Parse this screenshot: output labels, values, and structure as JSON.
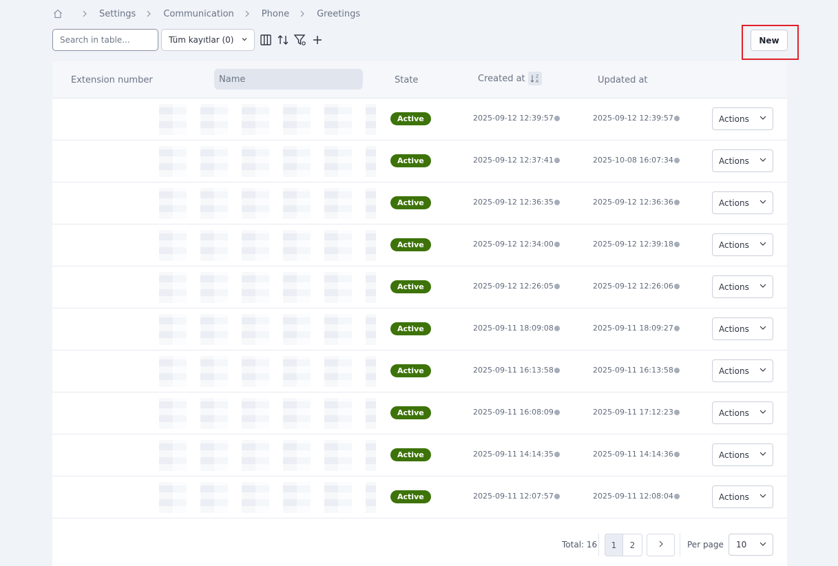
{
  "breadcrumb": {
    "items": [
      "Settings",
      "Communication",
      "Phone",
      "Greetings"
    ]
  },
  "toolbar": {
    "search_placeholder": "Search in table...",
    "filter_value": "Tüm kayıtlar (0)",
    "new_label": "New"
  },
  "table": {
    "columns": {
      "extension": "Extension number",
      "name": "Name",
      "state": "State",
      "created": "Created at",
      "updated": "Updated at"
    },
    "rows": [
      {
        "state": "Active",
        "created": "2025-09-12 12:39:57",
        "updated": "2025-09-12 12:39:57",
        "actions": "Actions"
      },
      {
        "state": "Active",
        "created": "2025-09-12 12:37:41",
        "updated": "2025-10-08 16:07:34",
        "actions": "Actions"
      },
      {
        "state": "Active",
        "created": "2025-09-12 12:36:35",
        "updated": "2025-09-12 12:36:36",
        "actions": "Actions"
      },
      {
        "state": "Active",
        "created": "2025-09-12 12:34:00",
        "updated": "2025-09-12 12:39:18",
        "actions": "Actions"
      },
      {
        "state": "Active",
        "created": "2025-09-12 12:26:05",
        "updated": "2025-09-12 12:26:06",
        "actions": "Actions"
      },
      {
        "state": "Active",
        "created": "2025-09-11 18:09:08",
        "updated": "2025-09-11 18:09:27",
        "actions": "Actions"
      },
      {
        "state": "Active",
        "created": "2025-09-11 16:13:58",
        "updated": "2025-09-11 16:13:58",
        "actions": "Actions"
      },
      {
        "state": "Active",
        "created": "2025-09-11 16:08:09",
        "updated": "2025-09-11 17:12:23",
        "actions": "Actions"
      },
      {
        "state": "Active",
        "created": "2025-09-11 14:14:35",
        "updated": "2025-09-11 14:14:36",
        "actions": "Actions"
      },
      {
        "state": "Active",
        "created": "2025-09-11 12:07:57",
        "updated": "2025-09-11 12:08:04",
        "actions": "Actions"
      }
    ]
  },
  "pagination": {
    "total": "Total: 16",
    "pages": [
      "1",
      "2"
    ],
    "current_page": "1",
    "per_page_label": "Per page",
    "per_page_value": "10"
  },
  "colors": {
    "active_badge": "#3d7309",
    "highlight_border": "#e0202a",
    "background": "#f0f3f8"
  }
}
